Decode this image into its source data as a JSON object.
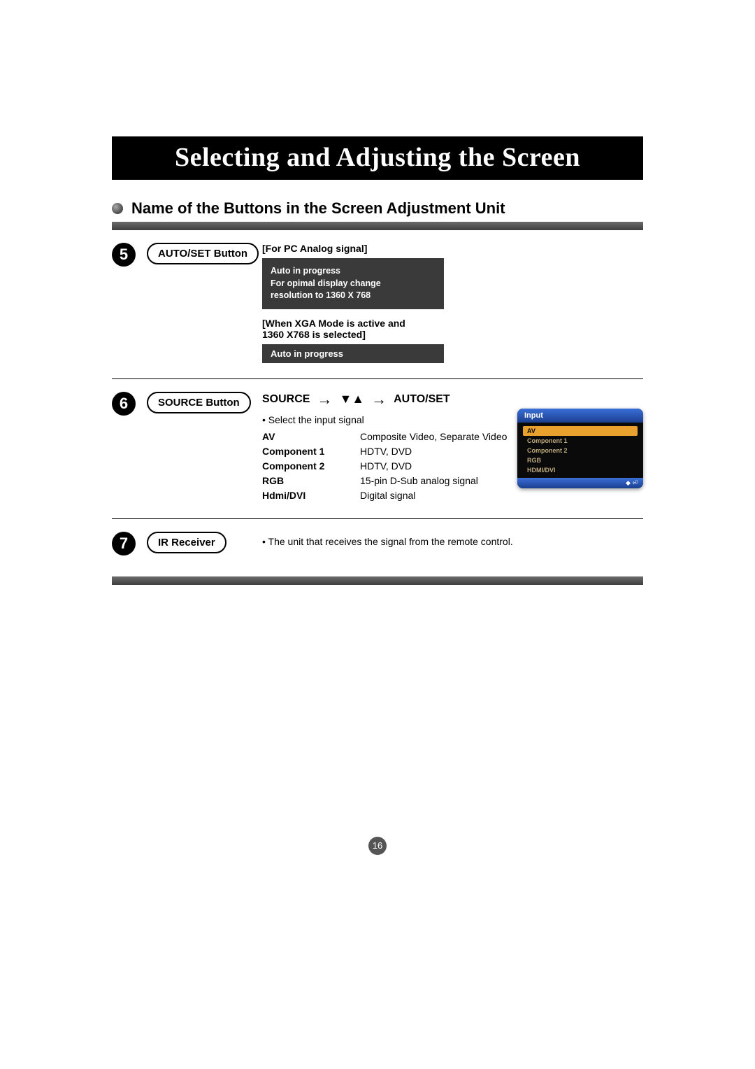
{
  "title": "Selecting and Adjusting the Screen",
  "subtitle": "Name of the Buttons in the Screen Adjustment Unit",
  "section5": {
    "num": "5",
    "label": "AUTO/SET Button",
    "bracket1": "[For PC Analog signal]",
    "osd1_line1": "Auto in progress",
    "osd1_line2": "For opimal display change",
    "osd1_line3": "resolution to 1360 X 768",
    "bracket2a": "[When XGA Mode is active and",
    "bracket2b": "1360 X768 is selected]",
    "osd2": "Auto in progress"
  },
  "section6": {
    "num": "6",
    "label": "SOURCE Button",
    "flow_source": "SOURCE",
    "flow_autoset": "AUTO/SET",
    "bullet": "• Select the input signal",
    "signals": [
      {
        "name": "AV",
        "desc": "Composite Video, Separate Video"
      },
      {
        "name": "Component 1",
        "desc": "HDTV, DVD"
      },
      {
        "name": "Component 2",
        "desc": "HDTV, DVD"
      },
      {
        "name": "RGB",
        "desc": "15-pin D-Sub analog signal"
      },
      {
        "name": "Hdmi/DVI",
        "desc": "Digital signal"
      }
    ],
    "menu": {
      "header": "Input",
      "items": [
        "AV",
        "Component 1",
        "Component 2",
        "RGB",
        "HDMI/DVI"
      ],
      "footer": "◆ ⏎"
    }
  },
  "section7": {
    "num": "7",
    "label": "IR Receiver",
    "desc": "• The unit that receives the signal from the remote control."
  },
  "page_number": "16"
}
